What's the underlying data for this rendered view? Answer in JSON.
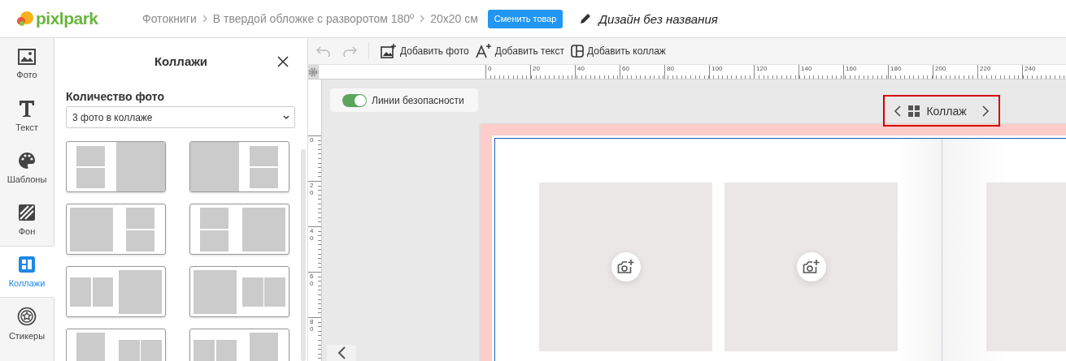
{
  "header": {
    "logo": "pixlpark",
    "breadcrumbs": [
      "Фотокниги",
      "В твердой обложке с разворотом 180º",
      "20x20 см"
    ],
    "change_button": "Сменить товар",
    "design_title": "Дизайн без названия"
  },
  "rail": [
    {
      "kind": "photo",
      "label": "Фото",
      "selected": false
    },
    {
      "kind": "text",
      "label": "Текст",
      "selected": false
    },
    {
      "kind": "palette",
      "label": "Шаблоны",
      "selected": false
    },
    {
      "kind": "background",
      "label": "Фон",
      "selected": false
    },
    {
      "kind": "collage",
      "label": "Коллажи",
      "selected": true
    },
    {
      "kind": "sticker",
      "label": "Стикеры",
      "selected": false
    }
  ],
  "panel": {
    "title": "Коллажи",
    "count_label": "Количество фото",
    "count_select": "3 фото в коллаже",
    "layouts": [
      {
        "kind": "pair-left-fill-right"
      },
      {
        "kind": "fill-left-pair-right"
      },
      {
        "kind": "big-left-pair-right"
      },
      {
        "kind": "pair-left-big-right"
      },
      {
        "kind": "duo-left-big-right"
      },
      {
        "kind": "big-left-duo-right"
      },
      {
        "kind": "tall-left-duo-right"
      },
      {
        "kind": "duo-left-tall-right"
      }
    ]
  },
  "toolbar": {
    "actions": [
      {
        "kind": "photo",
        "label": "Добавить фото"
      },
      {
        "kind": "text",
        "label": "Добавить текст"
      },
      {
        "kind": "collage",
        "label": "Добавить коллаж"
      }
    ]
  },
  "rulers": {
    "horizontal": [
      "0",
      "20",
      "40",
      "60",
      "80",
      "100",
      "120",
      "140",
      "160",
      "180",
      "200",
      "220",
      "240"
    ],
    "vertical": [
      "0",
      "20",
      "40",
      "60",
      "80"
    ]
  },
  "safety_lines": {
    "label": "Линии безопасности",
    "on": true
  },
  "collage_nav": {
    "label": "Коллаж"
  }
}
